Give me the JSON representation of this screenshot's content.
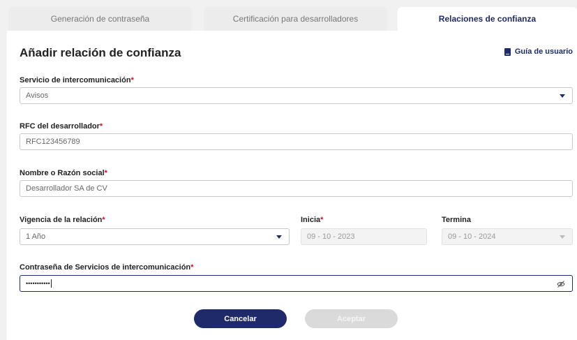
{
  "tabs": [
    {
      "label": "Generación de contraseña"
    },
    {
      "label": "Certificación para desarrolladores"
    },
    {
      "label": "Relaciones de confianza"
    }
  ],
  "page": {
    "title": "Añadir relación de confianza",
    "guide_label": "Guía de usuario"
  },
  "form": {
    "service_label": "Servicio de intercomunicación",
    "service_value": "Avisos",
    "rfc_label": "RFC del desarrollador",
    "rfc_value": "RFC123456789",
    "name_label": "Nombre o Razón social",
    "name_value": "Desarrollador SA de CV",
    "validity_label": "Vigencia de la relación",
    "validity_value": "1 Año",
    "start_label": "Inicia",
    "start_value": "09 - 10 - 2023",
    "end_label": "Termina",
    "end_value": "09 - 10 - 2024",
    "password_label": "Contraseña de Servicios de intercomunicación",
    "password_value": "•••••••••••",
    "required_mark": "*"
  },
  "actions": {
    "cancel_label": "Cancelar",
    "accept_label": "Aceptar"
  },
  "colors": {
    "primary": "#1f2a6b",
    "required": "#c8102e",
    "disabled": "#dadada"
  },
  "icons": {
    "guide": "book-icon",
    "dropdown": "chevron-down-icon",
    "password_toggle": "eye-off-icon"
  }
}
